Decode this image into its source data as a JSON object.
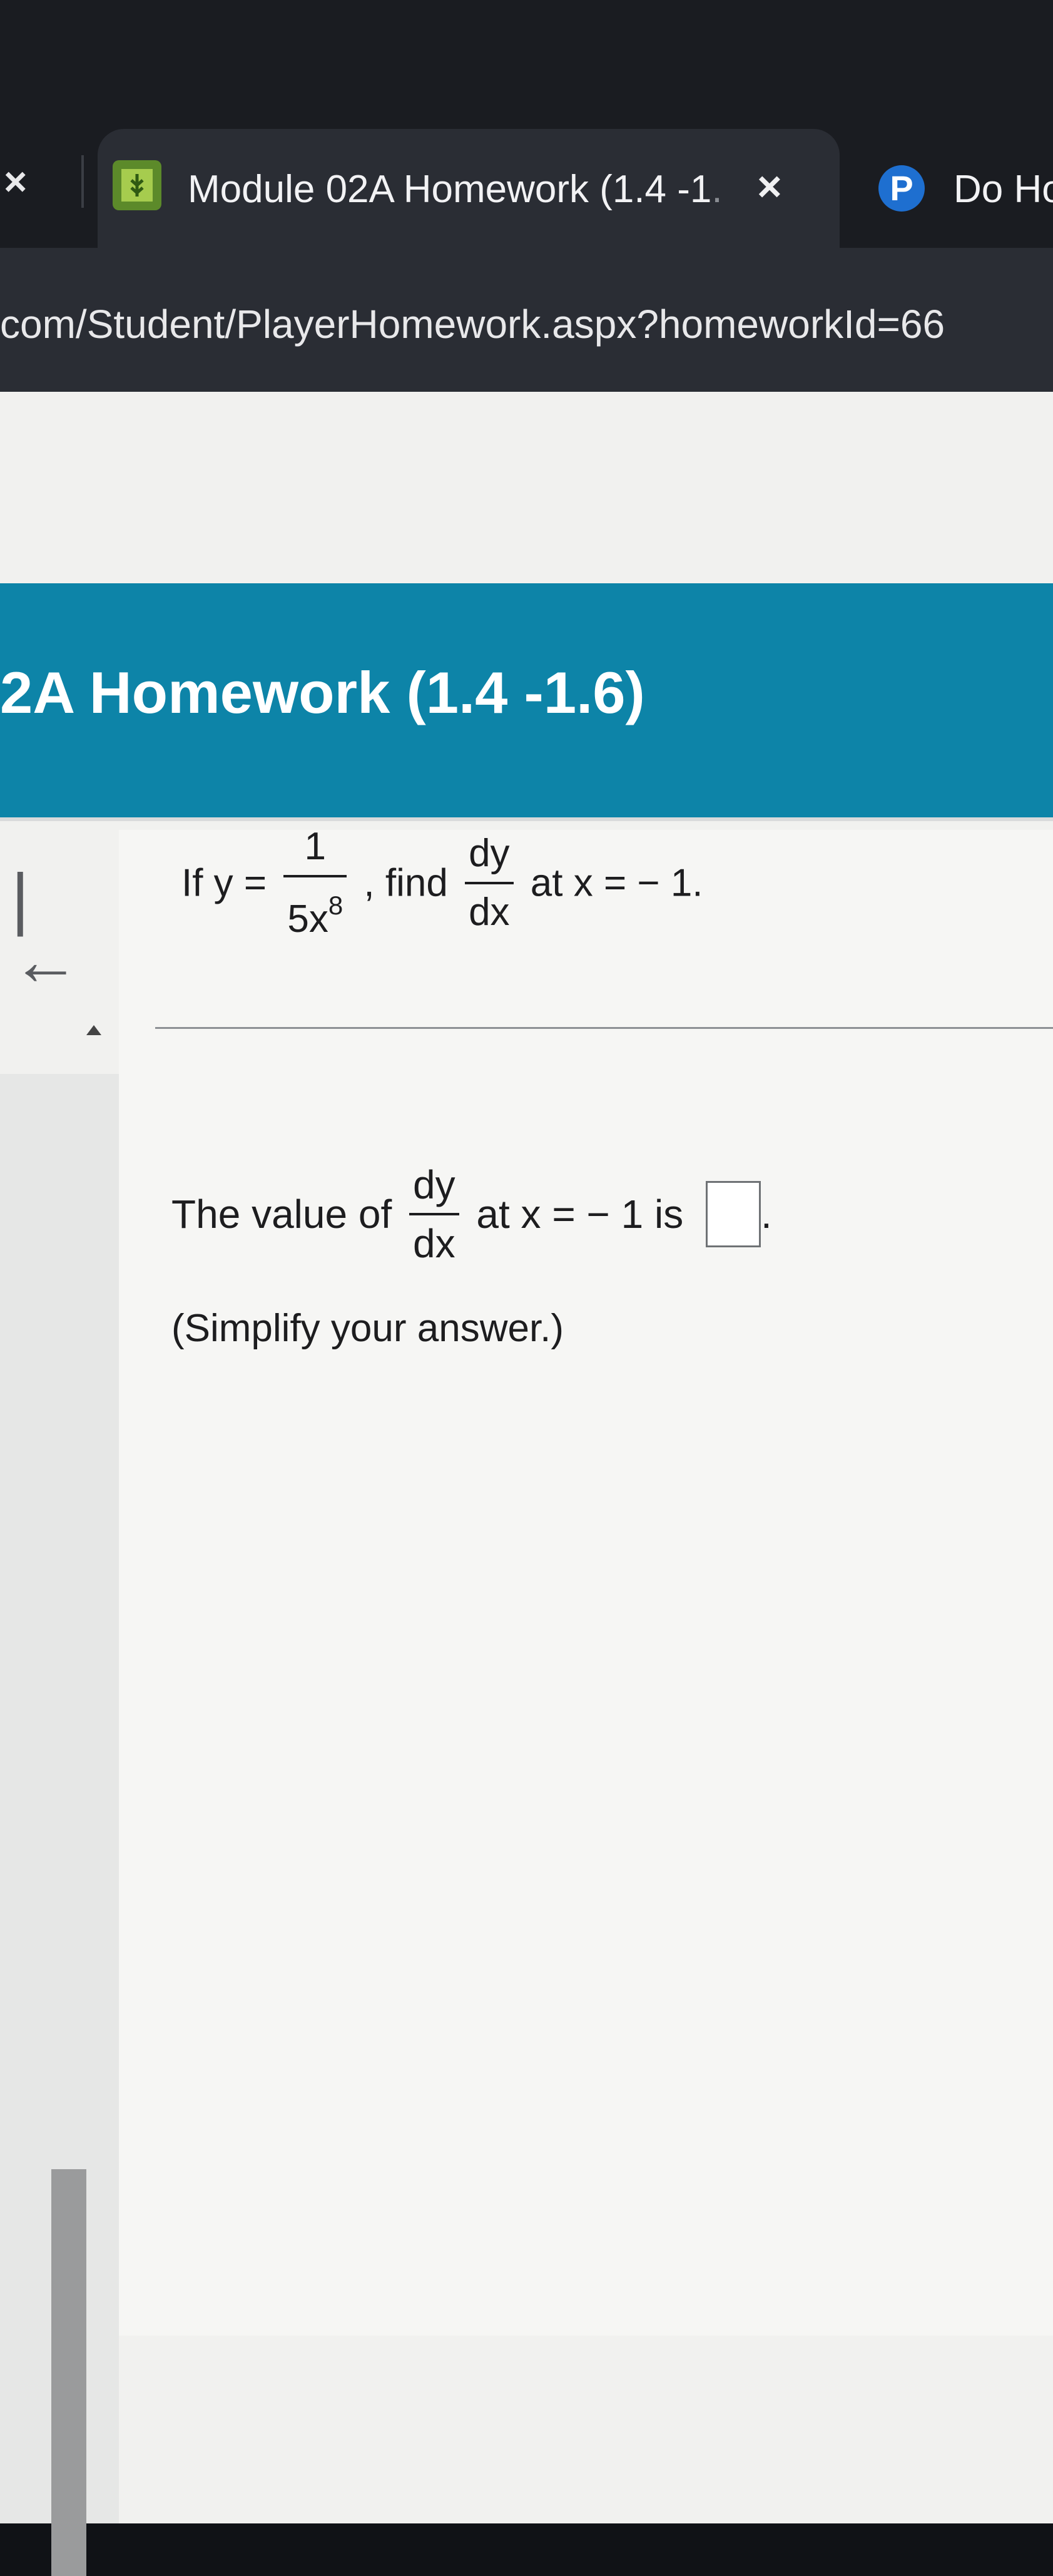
{
  "browser": {
    "prev_tab_close": "×",
    "active_tab": {
      "title": "Module 02A Homework (1.4 -1",
      "title_fade": ".",
      "close": "×"
    },
    "next_tab": {
      "icon_letter": "P",
      "title": "Do Ho"
    },
    "url": "com/Student/PlayerHomework.aspx?homeworkId=66"
  },
  "page": {
    "homework_title": "2A Homework (1.4 -1.6)",
    "nav_first_glyph": "|←",
    "question": {
      "prefix": "If y =",
      "y_num": "1",
      "y_den_base": "5x",
      "y_den_exp": "8",
      "mid": ", find",
      "deriv_num": "dy",
      "deriv_den": "dx",
      "suffix": "at x = − 1."
    },
    "answer": {
      "prefix": "The value of",
      "deriv_num": "dy",
      "deriv_den": "dx",
      "mid": "at x = − 1 is",
      "end": ".",
      "hint": "(Simplify your answer.)"
    }
  }
}
